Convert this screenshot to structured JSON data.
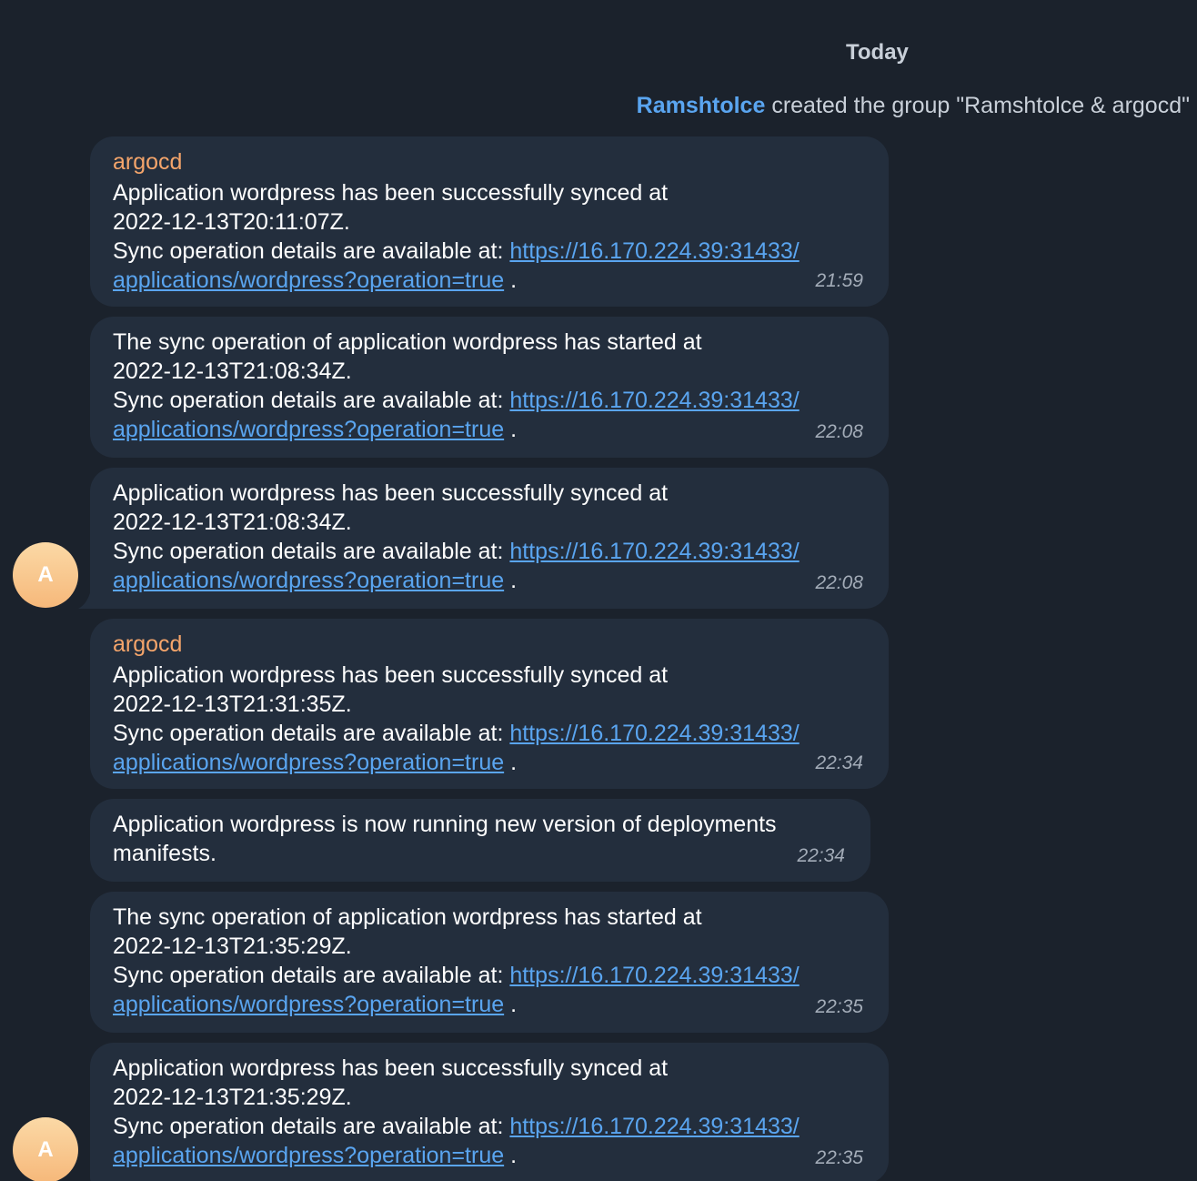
{
  "date_separator": "Today",
  "service": {
    "actor": "Ramshtolce",
    "text": " created the group \"Ramshtolce & argocd\""
  },
  "avatar_letter": "A",
  "messages": [
    {
      "sender": "argocd",
      "line1": "Application wordpress has been successfully synced at",
      "line2": "2022-12-13T20:11:07Z.",
      "details_prefix": "Sync operation details are available at: ",
      "link_part1": "https://16.170.224.39:31433/",
      "link_part2": "applications/wordpress?operation=true",
      "suffix": " .",
      "time": "21:59"
    },
    {
      "line1": "The sync operation of application wordpress has started at",
      "line2": "2022-12-13T21:08:34Z.",
      "details_prefix": "Sync operation details are available at: ",
      "link_part1": "https://16.170.224.39:31433/",
      "link_part2": "applications/wordpress?operation=true",
      "suffix": " .",
      "time": "22:08"
    },
    {
      "line1": "Application wordpress has been successfully synced at",
      "line2": "2022-12-13T21:08:34Z.",
      "details_prefix": "Sync operation details are available at: ",
      "link_part1": "https://16.170.224.39:31433/",
      "link_part2": "applications/wordpress?operation=true",
      "suffix": " .",
      "time": "22:08"
    },
    {
      "sender": "argocd",
      "line1": "Application wordpress has been successfully synced at",
      "line2": "2022-12-13T21:31:35Z.",
      "details_prefix": "Sync operation details are available at: ",
      "link_part1": "https://16.170.224.39:31433/",
      "link_part2": "applications/wordpress?operation=true",
      "suffix": " .",
      "time": "22:34"
    },
    {
      "line1": "Application wordpress is now running new version of deployments",
      "line2": "manifests.",
      "time": "22:34"
    },
    {
      "line1": "The sync operation of application wordpress has started at",
      "line2": "2022-12-13T21:35:29Z.",
      "details_prefix": "Sync operation details are available at: ",
      "link_part1": "https://16.170.224.39:31433/",
      "link_part2": "applications/wordpress?operation=true",
      "suffix": " .",
      "time": "22:35"
    },
    {
      "line1": "Application wordpress has been successfully synced at",
      "line2": "2022-12-13T21:35:29Z.",
      "details_prefix": "Sync operation details are available at: ",
      "link_part1": "https://16.170.224.39:31433/",
      "link_part2": "applications/wordpress?operation=true",
      "suffix": " .",
      "time": "22:35"
    }
  ]
}
